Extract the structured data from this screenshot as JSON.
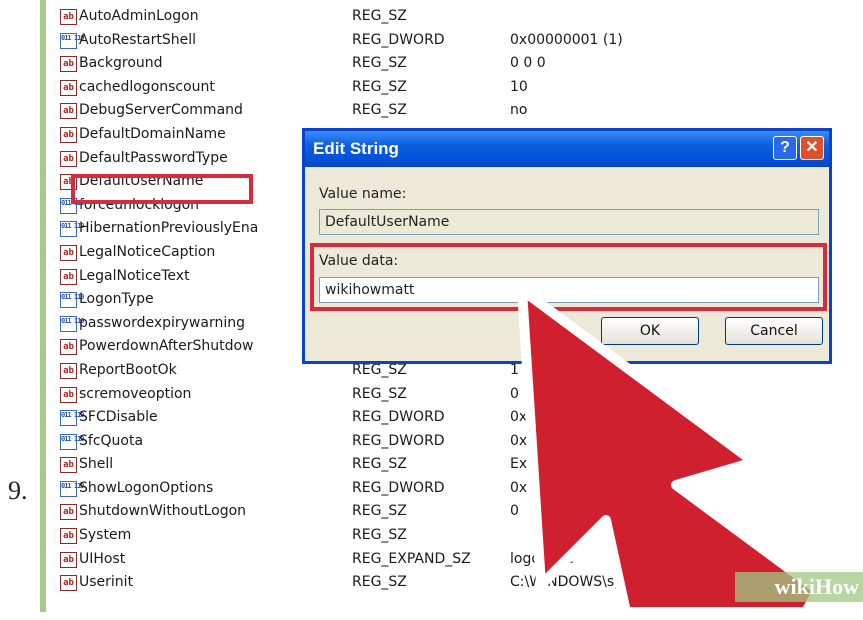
{
  "step_number": "9.",
  "registry": {
    "rows": [
      {
        "name": "AutoAdminLogon",
        "type": "REG_SZ",
        "value": "",
        "icon": "string-value-icon"
      },
      {
        "name": "AutoRestartShell",
        "type": "REG_DWORD",
        "value": "0x00000001 (1)",
        "icon": "dword-value-icon"
      },
      {
        "name": "Background",
        "type": "REG_SZ",
        "value": "0 0 0",
        "icon": "string-value-icon"
      },
      {
        "name": "cachedlogonscount",
        "type": "REG_SZ",
        "value": "10",
        "icon": "string-value-icon"
      },
      {
        "name": "DebugServerCommand",
        "type": "REG_SZ",
        "value": "no",
        "icon": "string-value-icon"
      },
      {
        "name": "DefaultDomainName",
        "type": "",
        "value": "",
        "icon": "string-value-icon"
      },
      {
        "name": "DefaultPasswordType",
        "type": "",
        "value": "",
        "icon": "string-value-icon"
      },
      {
        "name": "DefaultUserName",
        "type": "",
        "value": "",
        "icon": "string-value-icon"
      },
      {
        "name": "forceunlocklogon",
        "type": "",
        "value": "",
        "icon": "dword-value-icon"
      },
      {
        "name": "HibernationPreviouslyEna",
        "type": "",
        "value": "",
        "icon": "dword-value-icon"
      },
      {
        "name": "LegalNoticeCaption",
        "type": "",
        "value": "",
        "icon": "string-value-icon"
      },
      {
        "name": "LegalNoticeText",
        "type": "",
        "value": "",
        "icon": "string-value-icon"
      },
      {
        "name": "LogonType",
        "type": "",
        "value": "",
        "icon": "dword-value-icon"
      },
      {
        "name": "passwordexpirywarning",
        "type": "",
        "value": "",
        "icon": "dword-value-icon"
      },
      {
        "name": "PowerdownAfterShutdow",
        "type": "",
        "value": "",
        "icon": "string-value-icon"
      },
      {
        "name": "ReportBootOk",
        "type": "REG_SZ",
        "value": "1",
        "icon": "string-value-icon"
      },
      {
        "name": "scremoveoption",
        "type": "REG_SZ",
        "value": "0",
        "icon": "string-value-icon"
      },
      {
        "name": "SFCDisable",
        "type": "REG_DWORD",
        "value": "0x",
        "icon": "dword-value-icon"
      },
      {
        "name": "SfcQuota",
        "type": "REG_DWORD",
        "value": "0x",
        "icon": "dword-value-icon"
      },
      {
        "name": "Shell",
        "type": "REG_SZ",
        "value": "Ex",
        "icon": "string-value-icon"
      },
      {
        "name": "ShowLogonOptions",
        "type": "REG_DWORD",
        "value": "0x",
        "icon": "dword-value-icon"
      },
      {
        "name": "ShutdownWithoutLogon",
        "type": "REG_SZ",
        "value": "0",
        "icon": "string-value-icon"
      },
      {
        "name": "System",
        "type": "REG_SZ",
        "value": "",
        "icon": "string-value-icon"
      },
      {
        "name": "UIHost",
        "type": "REG_EXPAND_SZ",
        "value": "logo   .exe",
        "icon": "string-value-icon"
      },
      {
        "name": "Userinit",
        "type": "REG_SZ",
        "value": "C:\\WINDOWS\\syste      nit.exe,",
        "icon": "string-value-icon"
      }
    ]
  },
  "dialog": {
    "title": "Edit String",
    "help_glyph": "?",
    "close_glyph": "✕",
    "value_name_label": "Value name:",
    "value_name": "DefaultUserName",
    "value_data_label": "Value data:",
    "value_data": "wikihowmatt",
    "ok_label": "OK",
    "cancel_label": "Cancel"
  },
  "watermark": "wikiHow",
  "colors": {
    "highlight": "#d52b3b",
    "title_bar": "#0551d8",
    "dialog_bg": "#ece9d8"
  }
}
